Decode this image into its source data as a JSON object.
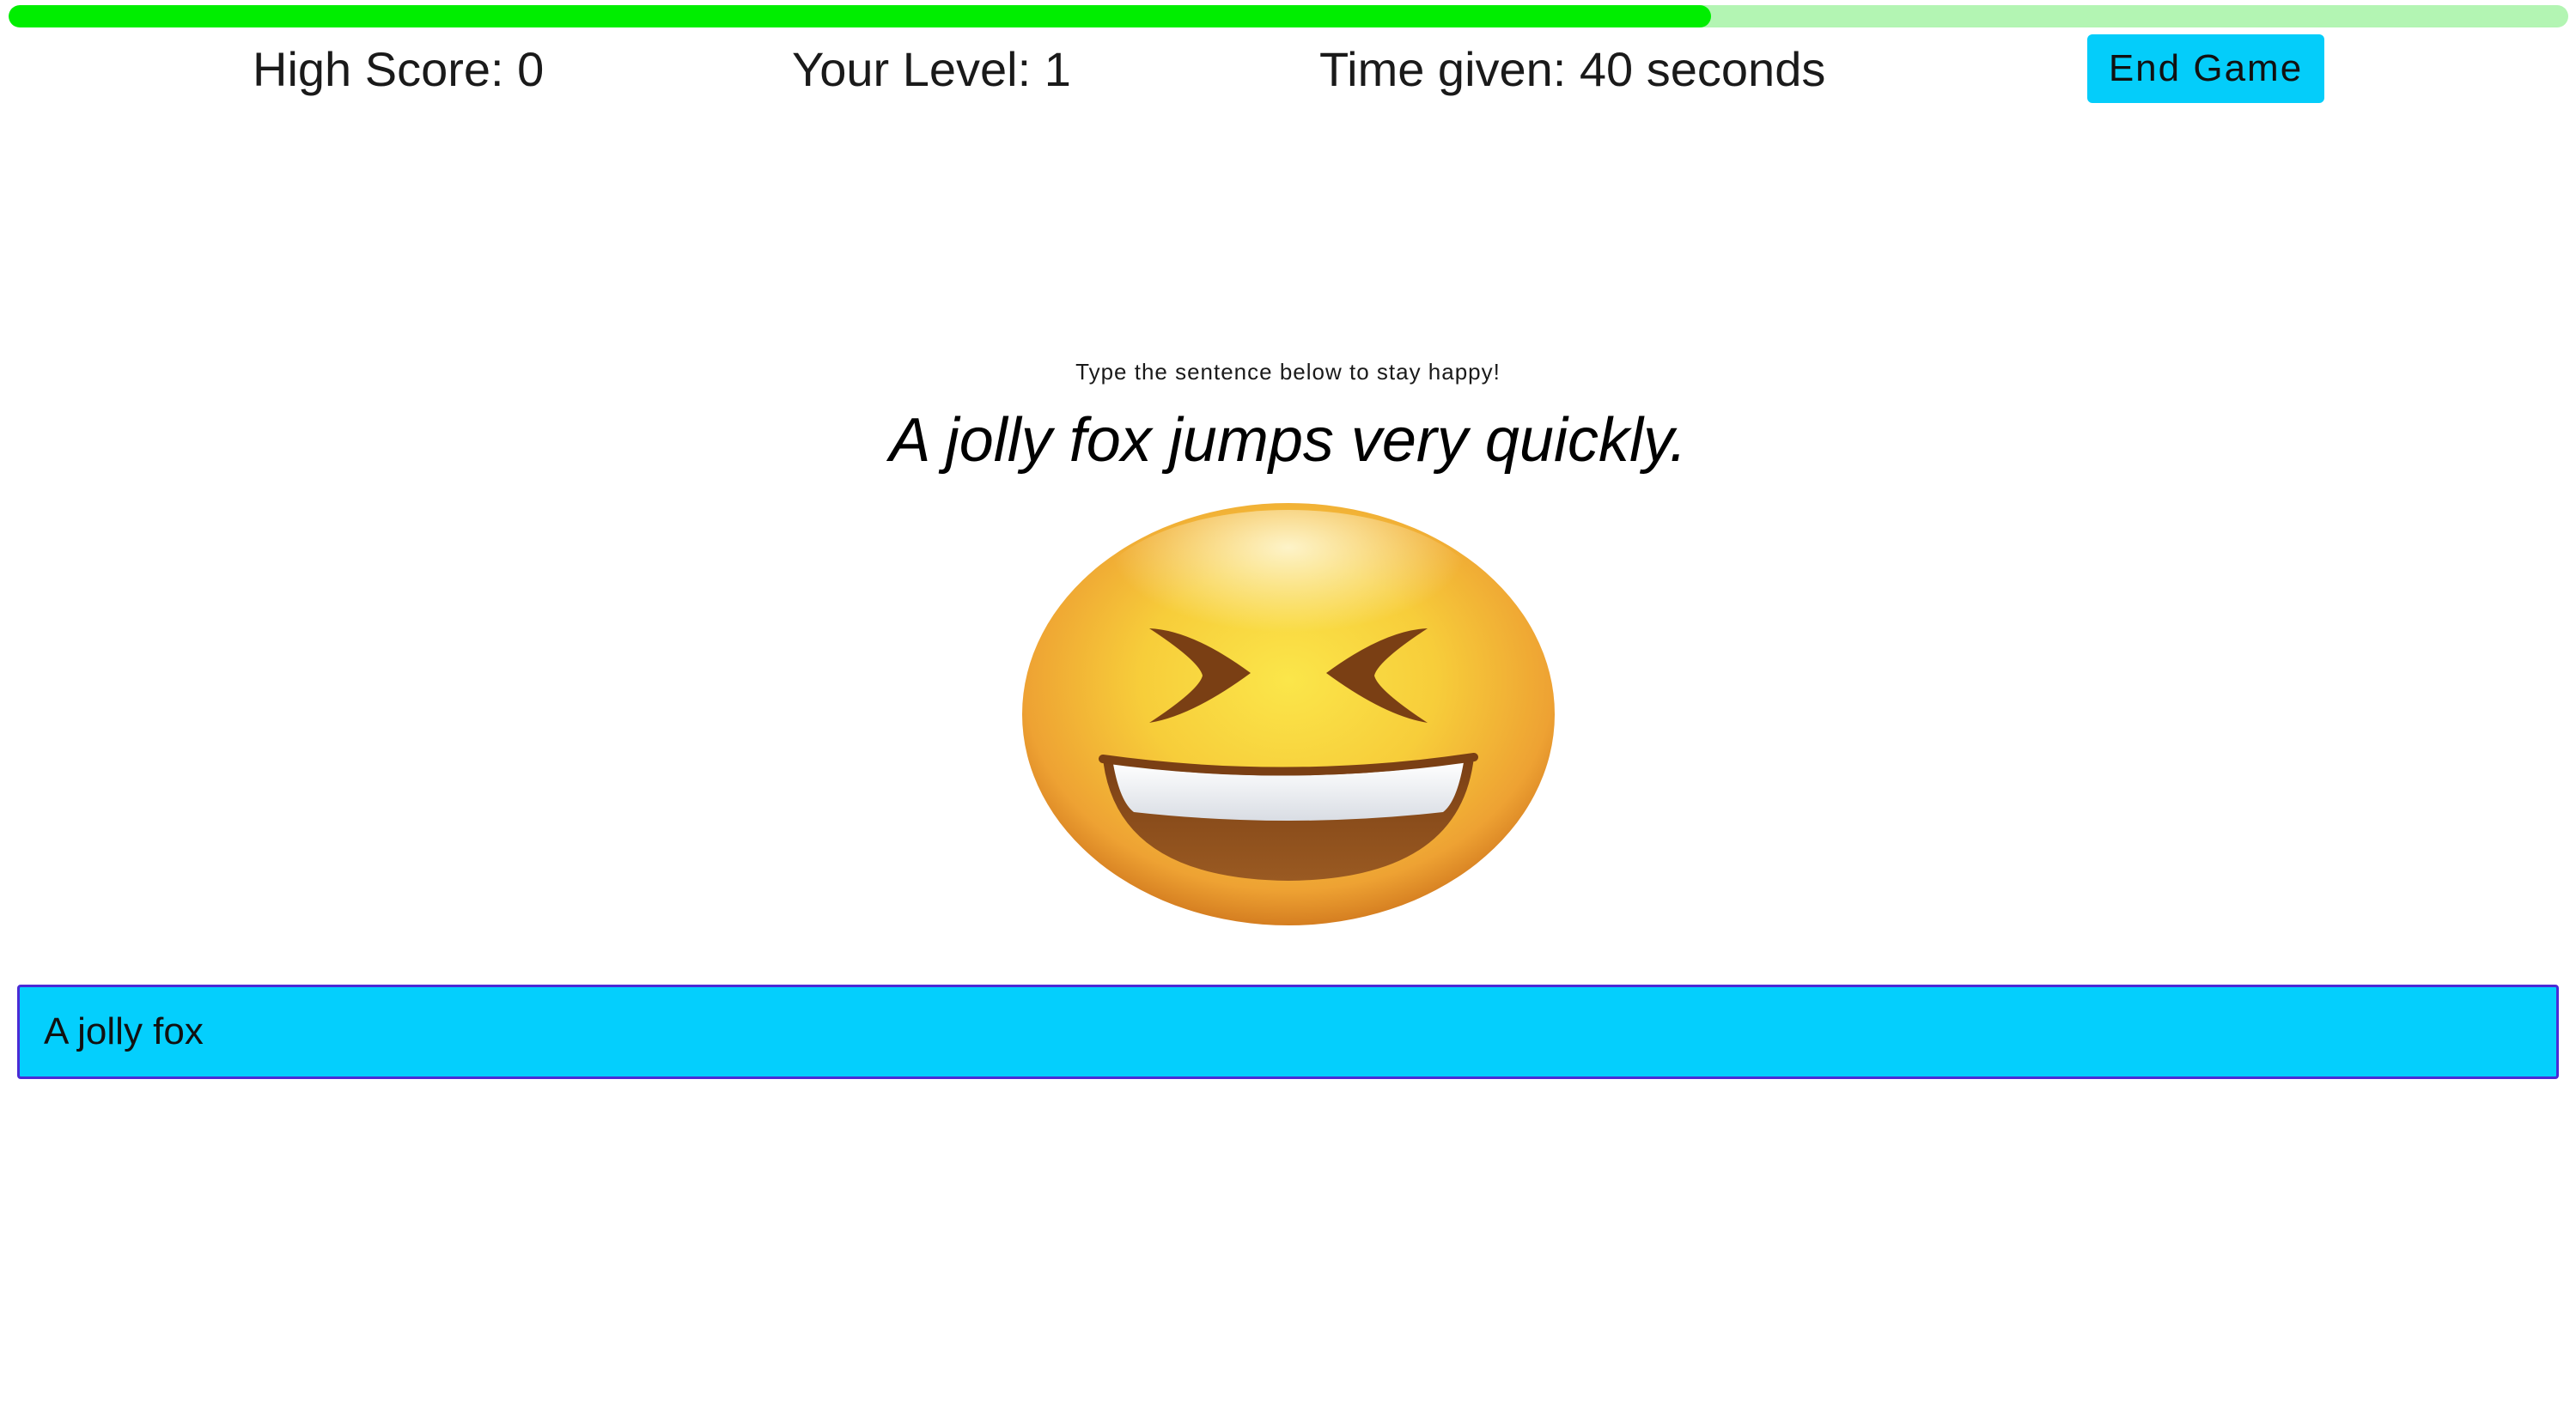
{
  "timer": {
    "remaining_fraction": 0.665,
    "fill_color": "#00ee00",
    "track_color": "#b3f5b3"
  },
  "header": {
    "high_score": "High Score: 0",
    "level": "Your Level: 1",
    "time_given": "Time given: 40 seconds",
    "end_button_label": "End Game",
    "end_button_color": "#04cdfa"
  },
  "prompt": {
    "instruction": "Type the sentence below to stay happy!",
    "sentence": "A jolly fox jumps very quickly."
  },
  "mood": {
    "icon": "grinning-squinting-face-icon"
  },
  "input": {
    "value": "A jolly fox",
    "background_color": "#04cffd",
    "border_color": "#4a2bd6"
  }
}
